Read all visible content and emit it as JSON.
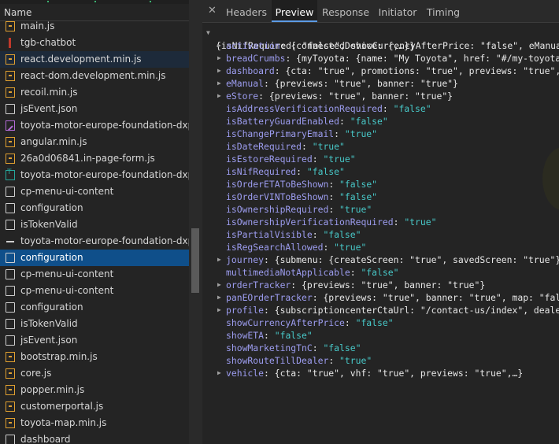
{
  "network_list": {
    "header": "Name",
    "items": [
      {
        "label": "main.js",
        "icon": "js-file-icon",
        "kind": "js"
      },
      {
        "label": "tgb-chatbot",
        "icon": "request-bar-icon",
        "kind": "bar"
      },
      {
        "label": "react.development.min.js",
        "icon": "js-file-icon",
        "kind": "js",
        "state": "hover"
      },
      {
        "label": "react-dom.development.min.js",
        "icon": "js-file-icon",
        "kind": "js"
      },
      {
        "label": "recoil.min.js",
        "icon": "js-file-icon",
        "kind": "js"
      },
      {
        "label": "jsEvent.json",
        "icon": "document-icon",
        "kind": "doc"
      },
      {
        "label": "toyota-motor-europe-foundation-dxp-in",
        "icon": "image-file-icon",
        "kind": "img"
      },
      {
        "label": "angular.min.js",
        "icon": "js-file-icon",
        "kind": "js"
      },
      {
        "label": "26a0d06841.in-page-form.js",
        "icon": "js-file-icon",
        "kind": "js"
      },
      {
        "label": "toyota-motor-europe-foundation-dxp-fo",
        "icon": "font-file-icon",
        "kind": "font"
      },
      {
        "label": "cp-menu-ui-content",
        "icon": "document-icon",
        "kind": "doc"
      },
      {
        "label": "configuration",
        "icon": "document-icon",
        "kind": "doc"
      },
      {
        "label": "isTokenValid",
        "icon": "document-icon",
        "kind": "doc"
      },
      {
        "label": "toyota-motor-europe-foundation-dxp-m",
        "icon": "dash-icon",
        "kind": "dash"
      },
      {
        "label": "configuration",
        "icon": "document-icon",
        "kind": "doc",
        "state": "selected"
      },
      {
        "label": "cp-menu-ui-content",
        "icon": "document-icon",
        "kind": "doc"
      },
      {
        "label": "cp-menu-ui-content",
        "icon": "document-icon",
        "kind": "doc"
      },
      {
        "label": "configuration",
        "icon": "document-icon",
        "kind": "doc"
      },
      {
        "label": "isTokenValid",
        "icon": "document-icon",
        "kind": "doc"
      },
      {
        "label": "jsEvent.json",
        "icon": "document-icon",
        "kind": "doc"
      },
      {
        "label": "bootstrap.min.js",
        "icon": "js-file-icon",
        "kind": "js"
      },
      {
        "label": "core.js",
        "icon": "js-file-icon",
        "kind": "js"
      },
      {
        "label": "popper.min.js",
        "icon": "js-file-icon",
        "kind": "js"
      },
      {
        "label": "customerportal.js",
        "icon": "js-file-icon",
        "kind": "js"
      },
      {
        "label": "toyota-map.min.js",
        "icon": "js-file-icon",
        "kind": "js"
      },
      {
        "label": "dashboard",
        "icon": "document-icon",
        "kind": "doc"
      }
    ]
  },
  "detail_tabs": {
    "close": "✕",
    "tabs": [
      {
        "label": "Headers",
        "active": false
      },
      {
        "label": "Preview",
        "active": true
      },
      {
        "label": "Response",
        "active": false
      },
      {
        "label": "Initiator",
        "active": false
      },
      {
        "label": "Timing",
        "active": false
      }
    ]
  },
  "preview": {
    "root": {
      "text": "{isNifRequired: \"false\", showCurrencyAfterPrice: \"false\", eManual: {previews: \"true\", banner: \"true\"},…}"
    },
    "entries": [
      {
        "key": "activation",
        "value": "{connectedDevice: {,…}}",
        "expandable": true,
        "type": "object"
      },
      {
        "key": "breadCrumbs",
        "value": "{myToyota: {name: \"My Toyota\", href: \"#/my-toyota/\"},…}",
        "expandable": true,
        "type": "object"
      },
      {
        "key": "dashboard",
        "value": "{cta: \"true\", promotions: \"true\", previews: \"true\", banner: \"true\"}",
        "expandable": true,
        "type": "object"
      },
      {
        "key": "eManual",
        "value": "{previews: \"true\", banner: \"true\"}",
        "expandable": true,
        "type": "object"
      },
      {
        "key": "eStore",
        "value": "{previews: \"true\", banner: \"true\"}",
        "expandable": true,
        "type": "object"
      },
      {
        "key": "isAddressVerificationRequired",
        "value": "\"false\"",
        "expandable": false,
        "type": "string"
      },
      {
        "key": "isBatteryGuardEnabled",
        "value": "\"false\"",
        "expandable": false,
        "type": "string"
      },
      {
        "key": "isChangePrimaryEmail",
        "value": "\"true\"",
        "expandable": false,
        "type": "string"
      },
      {
        "key": "isDateRequired",
        "value": "\"true\"",
        "expandable": false,
        "type": "string"
      },
      {
        "key": "isEstoreRequired",
        "value": "\"true\"",
        "expandable": false,
        "type": "string"
      },
      {
        "key": "isNifRequired",
        "value": "\"false\"",
        "expandable": false,
        "type": "string"
      },
      {
        "key": "isOrderETAToBeShown",
        "value": "\"false\"",
        "expandable": false,
        "type": "string"
      },
      {
        "key": "isOrderVINToBeShown",
        "value": "\"false\"",
        "expandable": false,
        "type": "string"
      },
      {
        "key": "isOwnershipRequired",
        "value": "\"true\"",
        "expandable": false,
        "type": "string"
      },
      {
        "key": "isOwnershipVerificationRequired",
        "value": "\"true\"",
        "expandable": false,
        "type": "string"
      },
      {
        "key": "isPartialVisible",
        "value": "\"false\"",
        "expandable": false,
        "type": "string"
      },
      {
        "key": "isRegSearchAllowed",
        "value": "\"true\"",
        "expandable": false,
        "type": "string"
      },
      {
        "key": "journey",
        "value": "{submenu: {createScreen: \"true\", savedScreen: \"true\"},…}",
        "expandable": true,
        "type": "object"
      },
      {
        "key": "multimediaNotApplicable",
        "value": "\"false\"",
        "expandable": false,
        "type": "string"
      },
      {
        "key": "orderTracker",
        "value": "{previews: \"true\", banner: \"true\"}",
        "expandable": true,
        "type": "object"
      },
      {
        "key": "panEOrderTracker",
        "value": "{previews: \"true\", banner: \"true\", map: \"false\"}",
        "expandable": true,
        "type": "object"
      },
      {
        "key": "profile",
        "value": "{subscriptioncenterCtaUrl: \"/contact-us/index\", dealerFinder: \"true\"}",
        "expandable": true,
        "type": "object"
      },
      {
        "key": "showCurrencyAfterPrice",
        "value": "\"false\"",
        "expandable": false,
        "type": "string"
      },
      {
        "key": "showETA",
        "value": "\"false\"",
        "expandable": false,
        "type": "string"
      },
      {
        "key": "showMarketingTnC",
        "value": "\"false\"",
        "expandable": false,
        "type": "string"
      },
      {
        "key": "showRouteTillDealer",
        "value": "\"true\"",
        "expandable": false,
        "type": "string"
      },
      {
        "key": "vehicle",
        "value": "{cta: \"true\", vhf: \"true\", previews: \"true\",…}",
        "expandable": true,
        "type": "object"
      }
    ]
  },
  "colors": {
    "background": "#242424",
    "selected_row": "#0f4f8a",
    "key": "#9d9df0",
    "string_value": "#48c8c8",
    "js_icon": "#e0a030",
    "active_tab_underline": "#5c9be6"
  }
}
